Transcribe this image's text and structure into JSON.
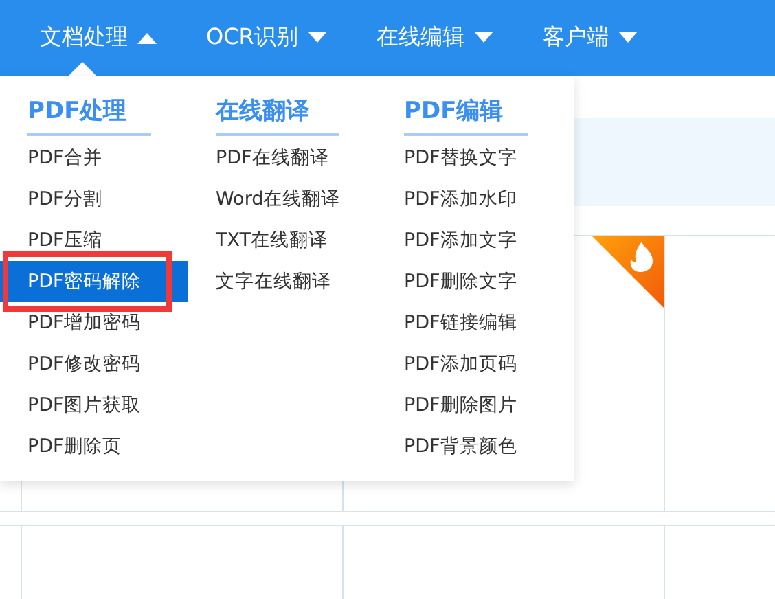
{
  "nav": [
    {
      "label": "文档处理",
      "expanded": true
    },
    {
      "label": "OCR识别",
      "expanded": false
    },
    {
      "label": "在线编辑",
      "expanded": false
    },
    {
      "label": "客户端",
      "expanded": false
    }
  ],
  "menu": {
    "columns": [
      {
        "heading": "PDF处理",
        "items": [
          {
            "label": "PDF合并",
            "selected": false,
            "annotated": false
          },
          {
            "label": "PDF分割",
            "selected": false,
            "annotated": false
          },
          {
            "label": "PDF压缩",
            "selected": false,
            "annotated": false
          },
          {
            "label": "PDF密码解除",
            "selected": true,
            "annotated": true
          },
          {
            "label": "PDF增加密码",
            "selected": false,
            "annotated": false
          },
          {
            "label": "PDF修改密码",
            "selected": false,
            "annotated": false
          },
          {
            "label": "PDF图片获取",
            "selected": false,
            "annotated": false
          },
          {
            "label": "PDF删除页",
            "selected": false,
            "annotated": false
          }
        ]
      },
      {
        "heading": "在线翻译",
        "items": [
          {
            "label": "PDF在线翻译",
            "selected": false,
            "annotated": false
          },
          {
            "label": "Word在线翻译",
            "selected": false,
            "annotated": false
          },
          {
            "label": "TXT在线翻译",
            "selected": false,
            "annotated": false
          },
          {
            "label": "文字在线翻译",
            "selected": false,
            "annotated": false
          }
        ]
      },
      {
        "heading": "PDF编辑",
        "items": [
          {
            "label": "PDF替换文字",
            "selected": false,
            "annotated": false
          },
          {
            "label": "PDF添加水印",
            "selected": false,
            "annotated": false
          },
          {
            "label": "PDF添加文字",
            "selected": false,
            "annotated": false
          },
          {
            "label": "PDF删除文字",
            "selected": false,
            "annotated": false
          },
          {
            "label": "PDF链接编辑",
            "selected": false,
            "annotated": false
          },
          {
            "label": "PDF添加页码",
            "selected": false,
            "annotated": false
          },
          {
            "label": "PDF删除图片",
            "selected": false,
            "annotated": false
          },
          {
            "label": "PDF背景颜色",
            "selected": false,
            "annotated": false
          }
        ]
      }
    ]
  },
  "page": {
    "hot_badge": true
  }
}
